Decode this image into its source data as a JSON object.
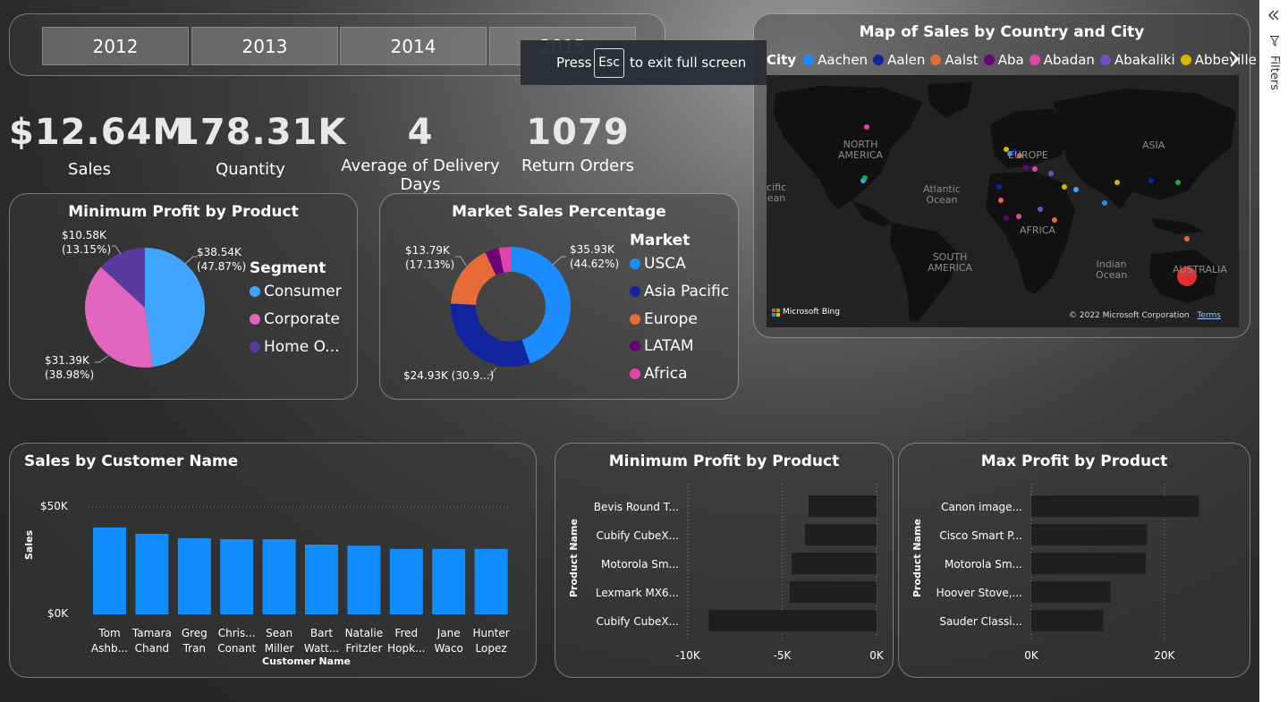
{
  "slicer": {
    "years": [
      "2012",
      "2013",
      "2014",
      "2015"
    ]
  },
  "toast": {
    "press": "Press",
    "key": "Esc",
    "message": "to exit full screen"
  },
  "kpis": [
    {
      "value": "$12.64M",
      "label": "Sales"
    },
    {
      "value": "178.31K",
      "label": "Quantity"
    },
    {
      "value": "4",
      "label": "Average of Delivery Days"
    },
    {
      "value": "1079",
      "label": "Return Orders"
    }
  ],
  "segment_pie": {
    "title": "Minimum Profit by Product",
    "legend_title": "Segment",
    "legend": [
      "Consumer",
      "Corporate",
      "Home O..."
    ],
    "labels": [
      "$38.54K\n(47.87%)",
      "$31.39K\n(38.98%)",
      "$10.58K\n(13.15%)"
    ]
  },
  "market_donut": {
    "title": "Market Sales Percentage",
    "legend_title": "Market",
    "legend": [
      "USCA",
      "Asia Pacific",
      "Europe",
      "LATAM",
      "Africa"
    ],
    "labels": [
      "$35.93K\n(44.62%)",
      "$24.93K (30.9...)",
      "$13.79K\n(17.13%)"
    ]
  },
  "map": {
    "title": "Map of Sales by Country and City",
    "legend_title": "City",
    "cities": [
      "Aachen",
      "Aalen",
      "Aalst",
      "Aba",
      "Abadan",
      "Abakaliki",
      "Abbeville"
    ],
    "continents": [
      "NORTH\nAMERICA",
      "EUROPE",
      "ASIA",
      "AFRICA",
      "SOUTH\nAMERICA",
      "AUSTRALIA",
      "Atlantic\nOcean",
      "Indian\nOcean",
      "cific\nean"
    ],
    "attribution": "Microsoft Bing",
    "copyright": "© 2022 Microsoft Corporation",
    "terms": "Terms"
  },
  "customer_bars": {
    "title": "Sales by Customer Name",
    "ylabel": "Sales",
    "xlabel": "Customer Name",
    "yticks": [
      "$50K",
      "$0K"
    ]
  },
  "min_profit_bars": {
    "title": "Minimum Profit by Product",
    "ylabel": "Product Name",
    "xticks": [
      "-10K",
      "-5K",
      "0K"
    ]
  },
  "max_profit_bars": {
    "title": "Max Profit by Product",
    "ylabel": "Product Name",
    "xticks": [
      "0K",
      "20K"
    ]
  },
  "filters_pane": {
    "label": "Filters"
  },
  "colors": {
    "consumer": "#41a5ff",
    "corporate": "#e066c0",
    "home_office": "#5a3a9e",
    "usca": "#1a8cff",
    "asia_pacific": "#12239e",
    "europe": "#e66c37",
    "latam": "#6b007b",
    "africa": "#e044a7",
    "bar_blue": "#118dff",
    "bar_dark": "#1f1f1f"
  },
  "chart_data": [
    {
      "type": "pie",
      "title": "Minimum Profit by Product",
      "categories": [
        "Consumer",
        "Corporate",
        "Home O..."
      ],
      "values": [
        38.54,
        31.39,
        10.58
      ],
      "percent": [
        47.87,
        38.98,
        13.15
      ],
      "unit": "$K",
      "legend": "right"
    },
    {
      "type": "pie",
      "title": "Market Sales Percentage",
      "categories": [
        "USCA",
        "Asia Pacific",
        "Europe",
        "LATAM",
        "Africa"
      ],
      "values": [
        35.93,
        24.93,
        13.79,
        3.0,
        2.6
      ],
      "percent": [
        44.62,
        30.96,
        17.13,
        3.7,
        3.2
      ],
      "unit": "$K",
      "legend": "right"
    },
    {
      "type": "bar",
      "title": "Sales by Customer Name",
      "categories": [
        "Tom\nAshb...",
        "Tamara\nChand",
        "Greg\nTran",
        "Chris...\nConant",
        "Sean\nMiller",
        "Bart\nWatt...",
        "Natalie\nFritzler",
        "Fred\nHopk...",
        "Jane\nWaco",
        "Hunter\nLopez"
      ],
      "values": [
        40.5,
        37.5,
        35.5,
        35.0,
        35.0,
        32.5,
        32.0,
        30.5,
        30.5,
        30.5
      ],
      "ylabel": "Sales",
      "xlabel": "Customer Name",
      "ylim": [
        0,
        50
      ]
    },
    {
      "type": "bar",
      "orientation": "horizontal",
      "title": "Minimum Profit by Product",
      "categories": [
        "Bevis Round T...",
        "Cubify CubeX...",
        "Motorola Sm...",
        "Lexmark MX6...",
        "Cubify CubeX..."
      ],
      "values": [
        -3.6,
        -3.8,
        -4.5,
        -4.6,
        -8.9
      ],
      "ylabel": "Product Name",
      "xlim": [
        -10,
        0
      ]
    },
    {
      "type": "bar",
      "orientation": "horizontal",
      "title": "Max Profit by Product",
      "categories": [
        "Canon image...",
        "Cisco Smart P...",
        "Motorola Sm...",
        "Hoover Stove,...",
        "Sauder Classi..."
      ],
      "values": [
        25.2,
        17.4,
        17.2,
        11.9,
        10.8
      ],
      "ylabel": "Product Name",
      "xlim": [
        0,
        25
      ]
    }
  ]
}
